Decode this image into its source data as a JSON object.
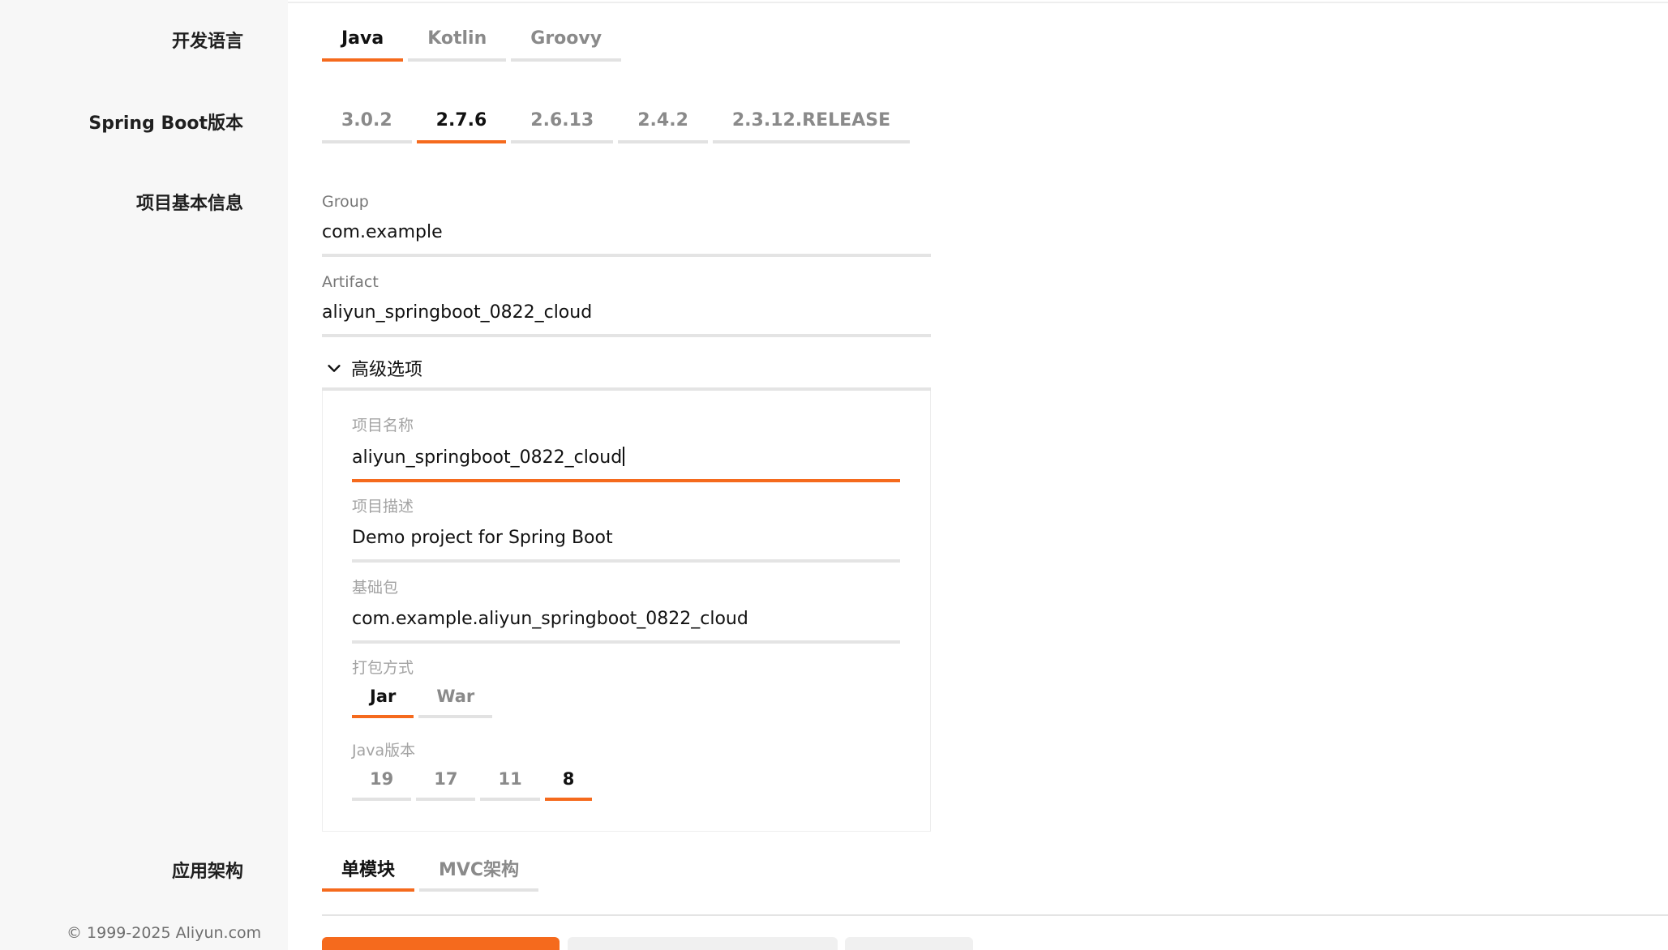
{
  "labels": {
    "language": "开发语言",
    "spring_boot": "Spring Boot版本",
    "project_info": "项目基本信息",
    "architecture": "应用架构"
  },
  "language_tabs": [
    "Java",
    "Kotlin",
    "Groovy"
  ],
  "language_selected": "Java",
  "spring_boot_tabs": [
    "3.0.2",
    "2.7.6",
    "2.6.13",
    "2.4.2",
    "2.3.12.RELEASE"
  ],
  "spring_boot_selected": "2.7.6",
  "group": {
    "label": "Group",
    "value": "com.example"
  },
  "artifact": {
    "label": "Artifact",
    "value": "aliyun_springboot_0822_cloud"
  },
  "advanced": {
    "toggle_label": "高级选项",
    "project_name": {
      "label": "项目名称",
      "value": "aliyun_springboot_0822_cloud"
    },
    "project_desc": {
      "label": "项目描述",
      "value": "Demo project for Spring Boot"
    },
    "base_package": {
      "label": "基础包",
      "value": "com.example.aliyun_springboot_0822_cloud"
    },
    "packaging_label": "打包方式",
    "packaging_tabs": [
      "Jar",
      "War"
    ],
    "packaging_selected": "Jar",
    "java_label": "Java版本",
    "java_tabs": [
      "19",
      "17",
      "11",
      "8"
    ],
    "java_selected": "8"
  },
  "architecture_tabs": [
    "单模块",
    "MVC架构"
  ],
  "architecture_selected": "单模块",
  "copyright": "© 1999-2025 Aliyun.com",
  "colors": {
    "accent": "#f56a1d",
    "inactive_underline": "#e2e2e2",
    "sidebar_bg": "#f7f7f7"
  }
}
